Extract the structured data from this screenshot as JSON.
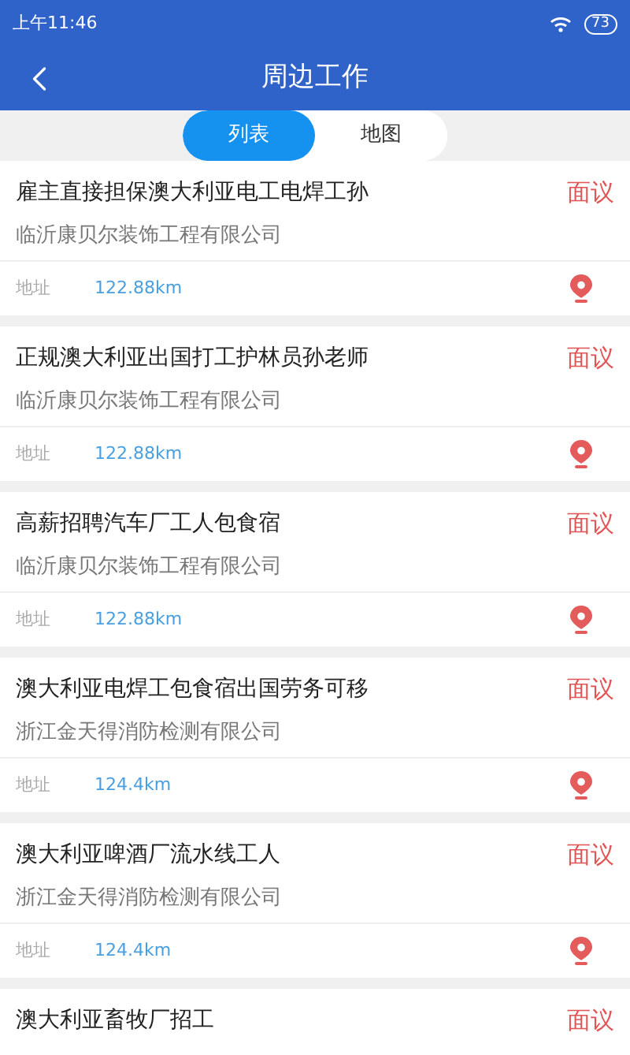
{
  "status_bar": {
    "time": "上午11:46",
    "battery": "73"
  },
  "header": {
    "title": "周边工作"
  },
  "tabs": [
    {
      "label": "列表",
      "selected": true
    },
    {
      "label": "地图",
      "selected": false
    }
  ],
  "jobs": [
    {
      "title": "雇主直接担保澳大利亚电工电焊工孙",
      "salary": "面议",
      "company": "临沂康贝尔装饰工程有限公司",
      "address_label": "地址",
      "distance": "122.88km"
    },
    {
      "title": "正规澳大利亚出国打工护林员孙老师",
      "salary": "面议",
      "company": "临沂康贝尔装饰工程有限公司",
      "address_label": "地址",
      "distance": "122.88km"
    },
    {
      "title": "高薪招聘汽车厂工人包食宿",
      "salary": "面议",
      "company": "临沂康贝尔装饰工程有限公司",
      "address_label": "地址",
      "distance": "122.88km"
    },
    {
      "title": "澳大利亚电焊工包食宿出国劳务可移",
      "salary": "面议",
      "company": "浙江金天得消防检测有限公司",
      "address_label": "地址",
      "distance": "124.4km"
    },
    {
      "title": "澳大利亚啤酒厂流水线工人",
      "salary": "面议",
      "company": "浙江金天得消防检测有限公司",
      "address_label": "地址",
      "distance": "124.4km"
    },
    {
      "title": "澳大利亚畜牧厂招工",
      "salary": "面议"
    }
  ]
}
